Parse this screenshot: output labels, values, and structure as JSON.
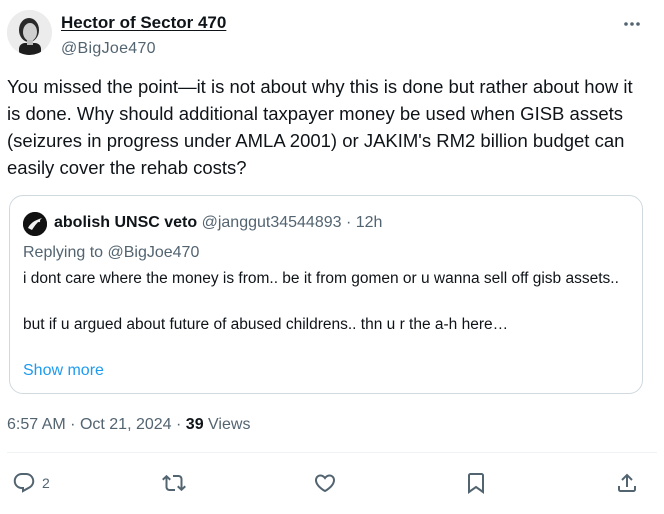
{
  "author": {
    "name": "Hector of Sector 470",
    "handle": "@BigJoe470",
    "avatar_icon": "profile-photo"
  },
  "more_icon": "ellipsis-icon",
  "tweet": {
    "text": "You missed the point—it is not about why this is done but rather about how it is done. Why should additional taxpayer money be used when GISB assets (seizures in progress under AMLA 2001) or JAKIM's RM2 billion budget can easily cover the rehab costs?"
  },
  "quote": {
    "name": "abolish UNSC veto",
    "handle": "@janggut34544893",
    "dot": "·",
    "time": "12h",
    "replying_to": "Replying to @BigJoe470",
    "body": "i dont care where the money is from.. be it from gomen or u wanna sell off gisb assets..\n\nbut if u argued about future of abused childrens.. thn u r the a-h here…",
    "show_more": "Show more"
  },
  "meta": {
    "time": "6:57 AM",
    "sep1": "·",
    "date": "Oct 21, 2024",
    "sep2": "·",
    "views_count": "39",
    "views_label": "Views"
  },
  "actions": {
    "reply_count": "2",
    "reply_icon": "reply-icon",
    "retweet_icon": "retweet-icon",
    "like_icon": "heart-icon",
    "bookmark_icon": "bookmark-icon",
    "share_icon": "share-icon"
  },
  "colors": {
    "text_primary": "#0f1419",
    "text_secondary": "#536471",
    "link": "#1d9bf0",
    "border": "#cfd9de"
  }
}
